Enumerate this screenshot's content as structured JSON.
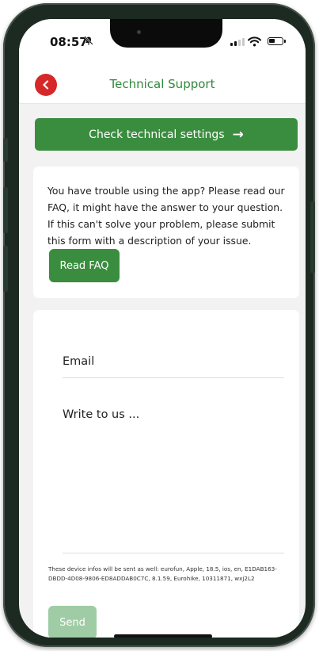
{
  "status_bar": {
    "time": "08:57"
  },
  "header": {
    "title": "Technical Support"
  },
  "settings_button": {
    "label": "Check technical settings",
    "arrow": "→"
  },
  "faq": {
    "description": "You have trouble using the app? Please read our FAQ, it might have the answer to your question. If this can't solve your problem, please submit this form with a description of your issue.",
    "button_label": "Read FAQ"
  },
  "form": {
    "email_placeholder": "Email",
    "message_placeholder": "Write to us ...",
    "device_info": "These device infos will be sent as well: eurofun, Apple, 18.5, ios, en, E1DAB163-DBDD-4D08-9806-ED8ADDAB0C7C, 8.1.59, Eurohike, 10311871, wxj2L2",
    "send_label": "Send"
  },
  "colors": {
    "accent_green": "#3a8d3f",
    "title_green": "#2f8a3a",
    "back_red": "#d62828",
    "send_disabled": "#9fcca4"
  },
  "icons": {
    "back": "chevron-left-icon",
    "settings_arrow": "arrow-right-icon",
    "mute": "bell-slash-icon"
  }
}
